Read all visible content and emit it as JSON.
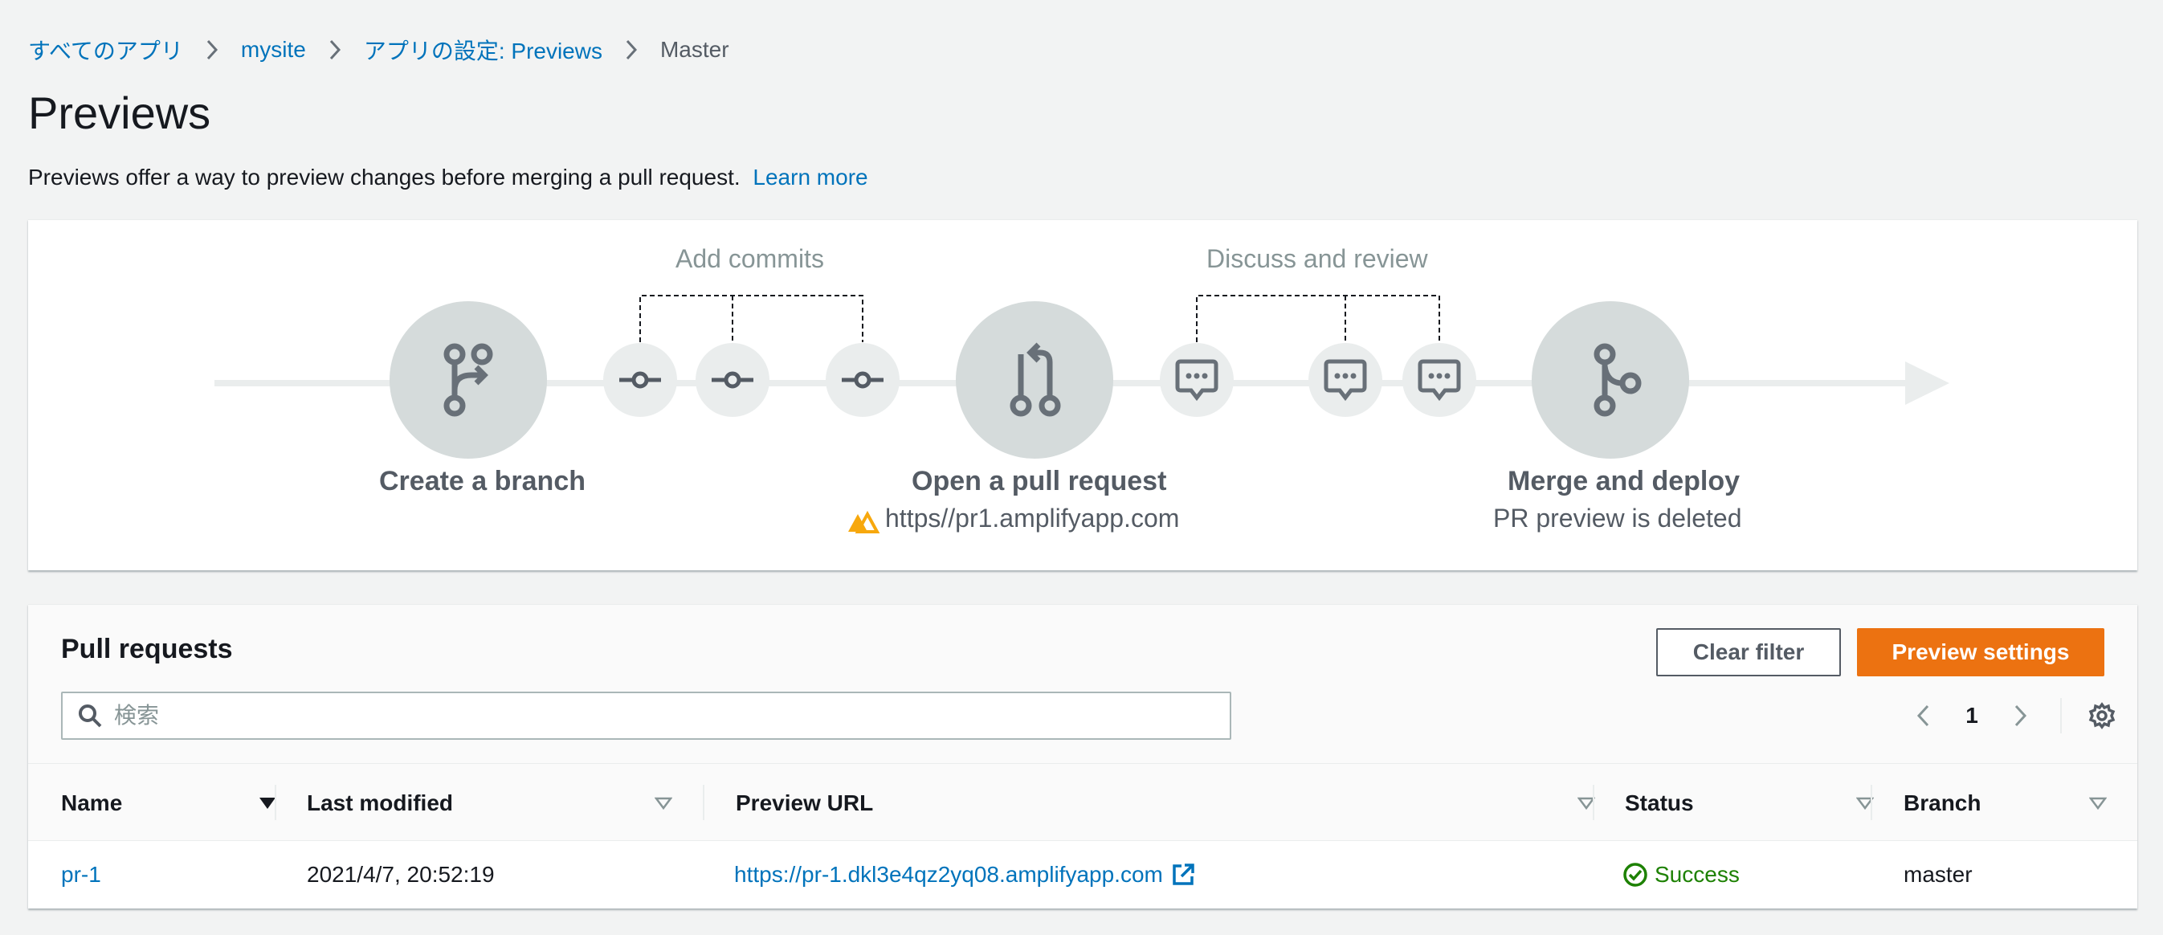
{
  "breadcrumb": {
    "items": [
      "すべてのアプリ",
      "mysite",
      "アプリの設定: Previews"
    ],
    "current": "Master"
  },
  "page": {
    "title": "Previews",
    "description": "Previews offer a way to preview changes before merging a pull request.",
    "learn_more": "Learn more"
  },
  "diagram": {
    "add_commits": "Add commits",
    "discuss_review": "Discuss and review",
    "steps": {
      "create_branch": "Create a branch",
      "open_pr": "Open a pull request",
      "merge_deploy": "Merge and deploy"
    },
    "pr_url": "https//pr1.amplifyapp.com",
    "deleted_note": "PR preview is deleted",
    "colors": {
      "circle": "#d5dbdb",
      "icon": "#687078",
      "line": "#eaeded",
      "amplify": "#f7a80d"
    }
  },
  "pull_requests": {
    "title": "Pull requests",
    "clear_filter": "Clear filter",
    "preview_settings": "Preview settings",
    "search_placeholder": "検索",
    "page": "1",
    "columns": {
      "name": "Name",
      "last_modified": "Last modified",
      "preview_url": "Preview URL",
      "status": "Status",
      "branch": "Branch"
    },
    "rows": [
      {
        "name": "pr-1",
        "last_modified": "2021/4/7, 20:52:19",
        "preview_url": "https://pr-1.dkl3e4qz2yq08.amplifyapp.com",
        "status": "Success",
        "branch": "master"
      }
    ]
  }
}
